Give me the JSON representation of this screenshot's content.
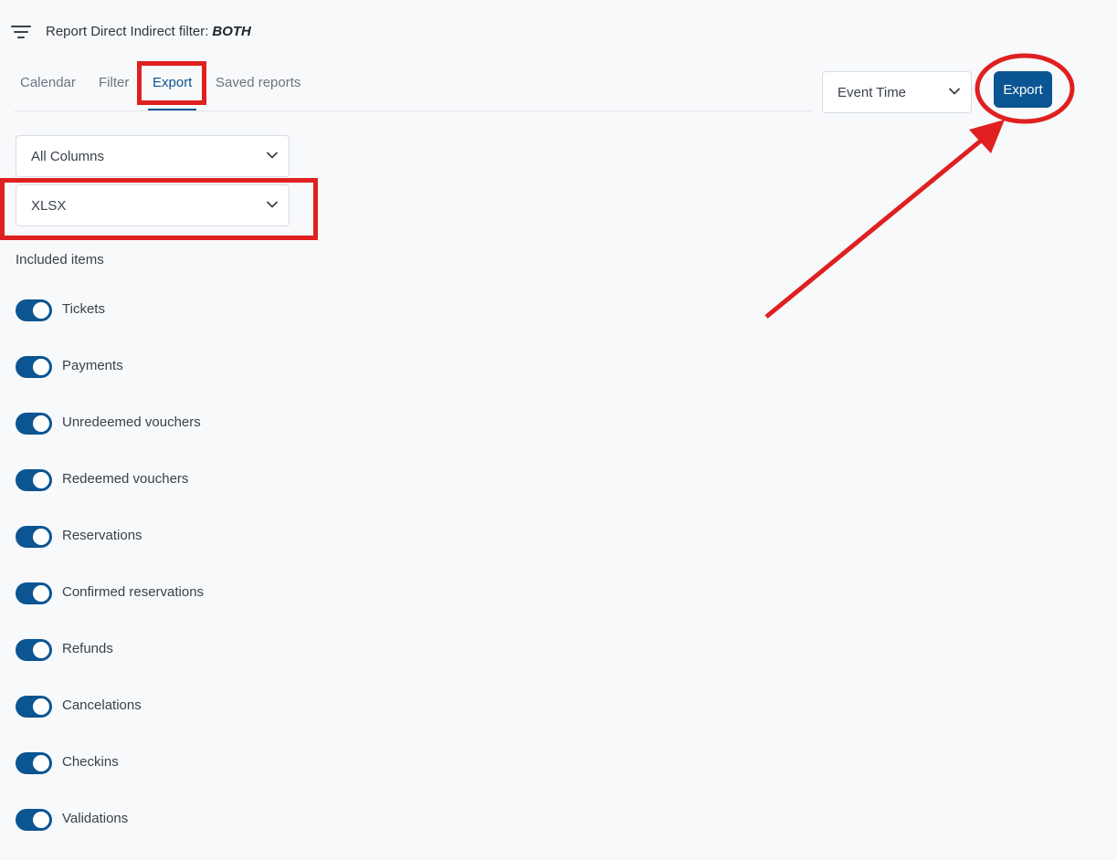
{
  "header": {
    "title": "Report Direct Indirect filter:",
    "value": "BOTH",
    "menu_icon": "filter-lines-icon"
  },
  "tabs": [
    {
      "label": "Calendar",
      "active": false
    },
    {
      "label": "Filter",
      "active": false
    },
    {
      "label": "Export",
      "active": true
    },
    {
      "label": "Saved reports",
      "active": false
    }
  ],
  "time_select": {
    "value": "Event Time"
  },
  "export_button": {
    "label": "Export"
  },
  "columns_select": {
    "value": "All Columns"
  },
  "format_select": {
    "value": "XLSX"
  },
  "included_items": {
    "label": "Included items",
    "items": [
      {
        "label": "Tickets",
        "on": true
      },
      {
        "label": "Payments",
        "on": true
      },
      {
        "label": "Unredeemed vouchers",
        "on": true
      },
      {
        "label": "Redeemed vouchers",
        "on": true
      },
      {
        "label": "Reservations",
        "on": true
      },
      {
        "label": "Confirmed reservations",
        "on": true
      },
      {
        "label": "Refunds",
        "on": true
      },
      {
        "label": "Cancelations",
        "on": true
      },
      {
        "label": "Checkins",
        "on": true
      },
      {
        "label": "Validations",
        "on": true
      }
    ]
  },
  "colors": {
    "accent": "#0b5592",
    "annotation": "#e02020",
    "background": "#f8f9fb"
  }
}
